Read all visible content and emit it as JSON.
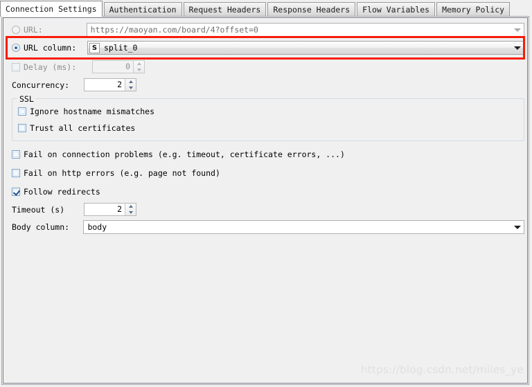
{
  "window": {
    "watermark": "https://blog.csdn.net/miles_ye"
  },
  "tabs": [
    {
      "label": "Connection Settings",
      "active": true
    },
    {
      "label": "Authentication",
      "active": false
    },
    {
      "label": "Request Headers",
      "active": false
    },
    {
      "label": "Response Headers",
      "active": false
    },
    {
      "label": "Flow Variables",
      "active": false
    },
    {
      "label": "Memory Policy",
      "active": false
    }
  ],
  "form": {
    "url": {
      "label": "URL:",
      "selected": false,
      "value": "https://maoyan.com/board/4?offset=0",
      "enabled": false
    },
    "url_column": {
      "label": "URL column:",
      "selected": true,
      "type_tag": "S",
      "value": "split_0",
      "enabled": true,
      "highlighted": true
    },
    "delay": {
      "label": "Delay (ms):",
      "checked": false,
      "value": "0",
      "enabled": false
    },
    "concurrency": {
      "label": "Concurrency:",
      "value": "2"
    },
    "ssl": {
      "title": "SSL",
      "options": [
        {
          "label": "Ignore hostname mismatches",
          "checked": false
        },
        {
          "label": "Trust all certificates",
          "checked": false
        }
      ]
    },
    "flags": [
      {
        "label": "Fail on connection problems (e.g. timeout, certificate errors, ...)",
        "checked": false
      },
      {
        "label": "Fail on http errors (e.g. page not found)",
        "checked": false
      },
      {
        "label": "Follow redirects",
        "checked": true
      }
    ],
    "timeout": {
      "label": "Timeout (s)",
      "value": "2"
    },
    "body_column": {
      "label": "Body column:",
      "value": "body"
    }
  },
  "icons": {
    "dropdown_arrow": "chevron-down-icon",
    "spinner_up": "spinner-up-icon",
    "spinner_down": "spinner-down-icon"
  }
}
